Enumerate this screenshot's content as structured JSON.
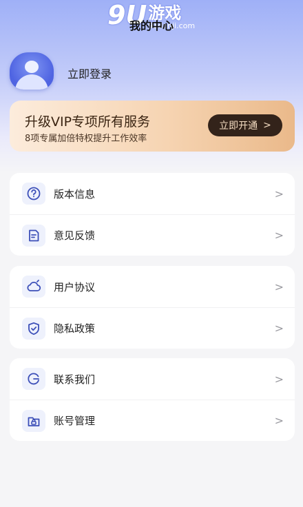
{
  "watermark": {
    "num": "9U",
    "text": "游戏",
    "site": "91danji.com"
  },
  "header": {
    "title": "我的中心"
  },
  "profile": {
    "login_label": "立即登录"
  },
  "vip": {
    "title": "升级VIP专项所有服务",
    "subtitle": "8项专属加倍特权提升工作效率",
    "button_label": "立即开通",
    "button_arrow": ">"
  },
  "groups": [
    {
      "items": [
        {
          "label": "版本信息",
          "icon": "question-circle-icon",
          "arrow": ">"
        },
        {
          "label": "意见反馈",
          "icon": "feedback-document-icon",
          "arrow": ">"
        }
      ]
    },
    {
      "items": [
        {
          "label": "用户协议",
          "icon": "cloud-icon",
          "arrow": ">"
        },
        {
          "label": "隐私政策",
          "icon": "shield-check-icon",
          "arrow": ">"
        }
      ]
    },
    {
      "items": [
        {
          "label": "联系我们",
          "icon": "contact-icon",
          "arrow": ">"
        },
        {
          "label": "账号管理",
          "icon": "lock-folder-icon",
          "arrow": ">"
        }
      ]
    }
  ],
  "colors": {
    "accent": "#4f64e2",
    "icon_stroke": "#3c4fb8",
    "vip_button": "#33231a"
  }
}
